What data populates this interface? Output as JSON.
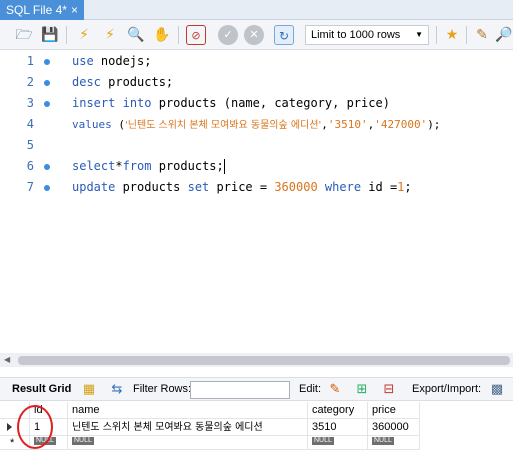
{
  "tab": {
    "title": "SQL File 4*",
    "close": "×"
  },
  "toolbar": {
    "icons": [
      "folder-open-icon",
      "save-icon",
      "execute-icon",
      "execute-current-icon",
      "explain-icon",
      "stop-icon",
      "toggle-continue-icon",
      "commit-icon",
      "rollback-icon",
      "autocommit-icon"
    ],
    "limit_label": "Limit to 1000 rows"
  },
  "editor": {
    "lines": [
      {
        "num": "1",
        "dot": true
      },
      {
        "num": "2",
        "dot": true
      },
      {
        "num": "3",
        "dot": true
      },
      {
        "num": "4",
        "dot": false
      },
      {
        "num": "5",
        "dot": false
      },
      {
        "num": "6",
        "dot": true
      },
      {
        "num": "7",
        "dot": true
      }
    ],
    "code": {
      "l1_kw": "use",
      "l1_rest": " nodejs;",
      "l2_kw": "desc",
      "l2_rest": " products;",
      "l3_kw1": "insert",
      "l3_mid": " ",
      "l3_kw2": "into",
      "l3_rest": " products (name, category, price)",
      "l4_kw": "values",
      "l4_a": " (",
      "l4_s1": "'닌텐도 스위치 본체 모여봐요 동물의숲 에디션'",
      "l4_c1": ",",
      "l4_s2": "'3510'",
      "l4_c2": ",",
      "l4_s3": "'427000'",
      "l4_end": ");",
      "l6_kw1": "select",
      "l6_star": "*",
      "l6_kw2": "from",
      "l6_rest": " products;",
      "l7_kw1": "update",
      "l7_a": " products ",
      "l7_kw2": "set",
      "l7_b": " price = ",
      "l7_n1": "360000",
      "l7_c": " ",
      "l7_kw3": "where",
      "l7_d": " id =",
      "l7_n2": "1",
      "l7_e": ";"
    }
  },
  "results": {
    "result_grid_label": "Result Grid",
    "filter_label": "Filter Rows:",
    "filter_value": "",
    "edit_label": "Edit:",
    "export_label": "Export/Import:",
    "columns": [
      "id",
      "name",
      "category",
      "price"
    ],
    "rows": [
      [
        "1",
        "닌텐도 스위치 본체 모여봐요 동물의숲 에디션",
        "3510",
        "360000"
      ]
    ],
    "new_row_marker": "*",
    "null_text": "NULL"
  }
}
